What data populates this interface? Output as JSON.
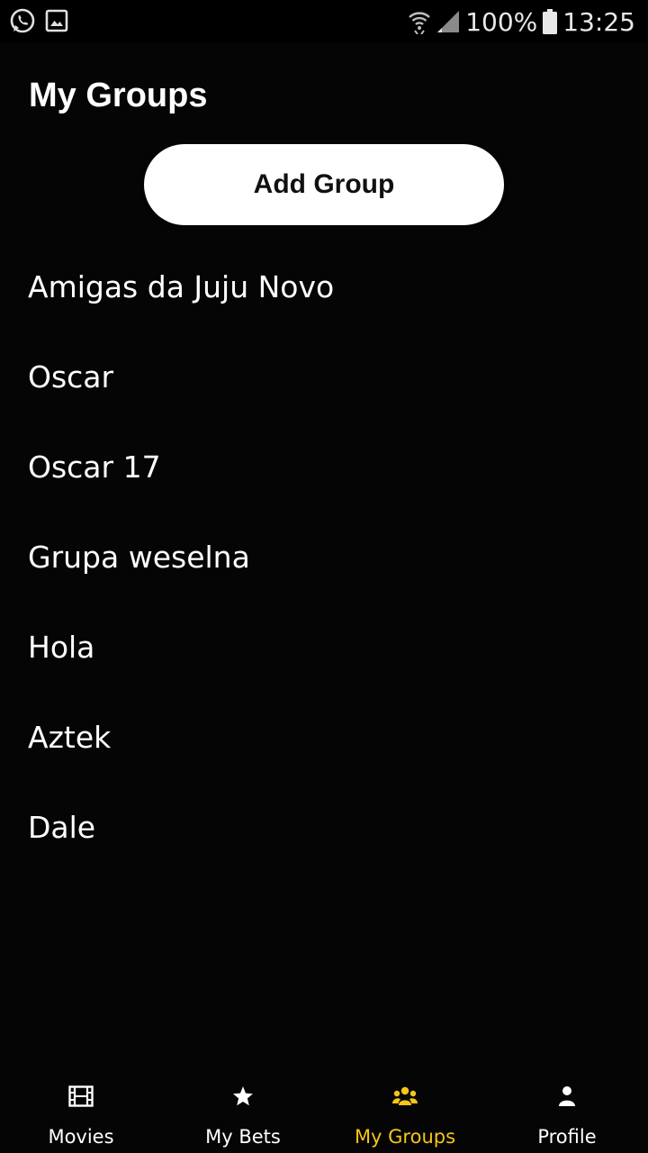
{
  "status_bar": {
    "left_icons": [
      "whatsapp-icon",
      "image-icon"
    ],
    "right_icons": [
      "wifi-icon",
      "signal-icon",
      "battery-icon"
    ],
    "battery_percent": "100%",
    "time": "13:25"
  },
  "header": {
    "title": "My Groups"
  },
  "actions": {
    "add_group_label": "Add Group"
  },
  "groups": [
    {
      "name": "Amigas da Juju Novo"
    },
    {
      "name": "Oscar"
    },
    {
      "name": "Oscar 17"
    },
    {
      "name": "Grupa weselna"
    },
    {
      "name": "Hola"
    },
    {
      "name": "Aztek"
    },
    {
      "name": "Dale"
    }
  ],
  "bottom_nav": {
    "active_color": "#f5c518",
    "items": [
      {
        "label": "Movies",
        "icon": "film-icon",
        "active": false
      },
      {
        "label": "My Bets",
        "icon": "star-icon",
        "active": false
      },
      {
        "label": "My Groups",
        "icon": "group-icon",
        "active": true
      },
      {
        "label": "Profile",
        "icon": "user-icon",
        "active": false
      }
    ]
  }
}
